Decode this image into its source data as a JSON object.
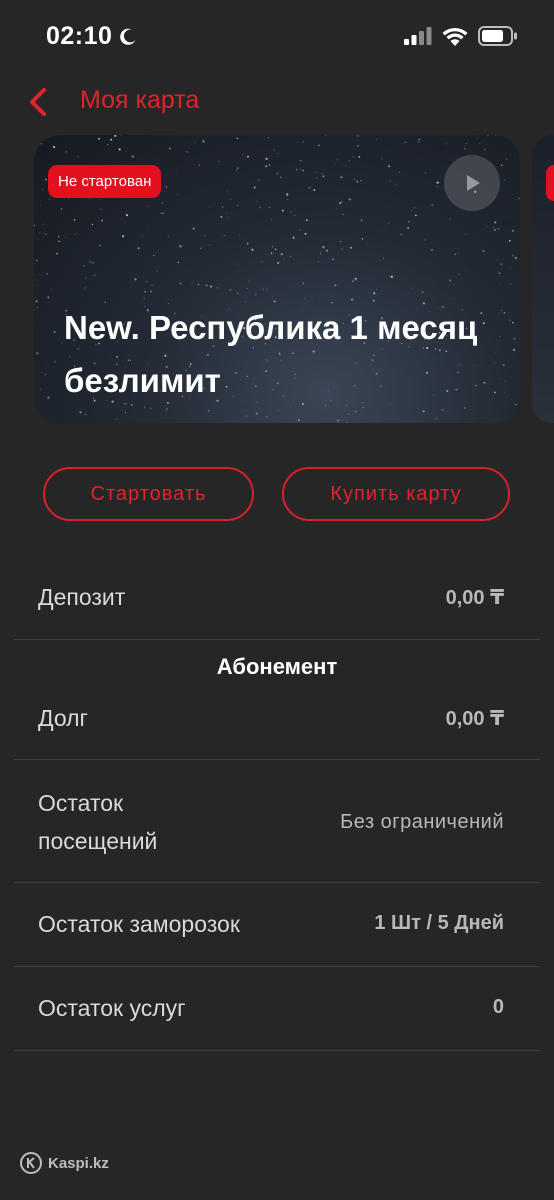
{
  "status_bar": {
    "time": "02:10"
  },
  "nav": {
    "title": "Моя карта"
  },
  "card": {
    "badge": "Не стартован",
    "title_line1": "New. Республика 1 месяц",
    "title_line2": "безлимит"
  },
  "actions": {
    "start_label": "Стартовать",
    "buy_label": "Купить карту"
  },
  "deposit": {
    "label": "Депозит",
    "value": "0,00 ₸"
  },
  "subscription": {
    "section_title": "Абонемент",
    "rows": [
      {
        "label": "Долг",
        "value": "0,00 ₸"
      },
      {
        "label_line1": "Остаток",
        "label_line2": "посещений",
        "value": "Без ограничений"
      },
      {
        "label": "Остаток заморозок",
        "value": "1 Шт / 5 Дней"
      },
      {
        "label": "Остаток услуг",
        "value": "0"
      }
    ]
  },
  "watermark": "Kaspi.kz",
  "colors": {
    "background": "#262626",
    "accent": "#e0242e",
    "badge": "#e3101f"
  }
}
